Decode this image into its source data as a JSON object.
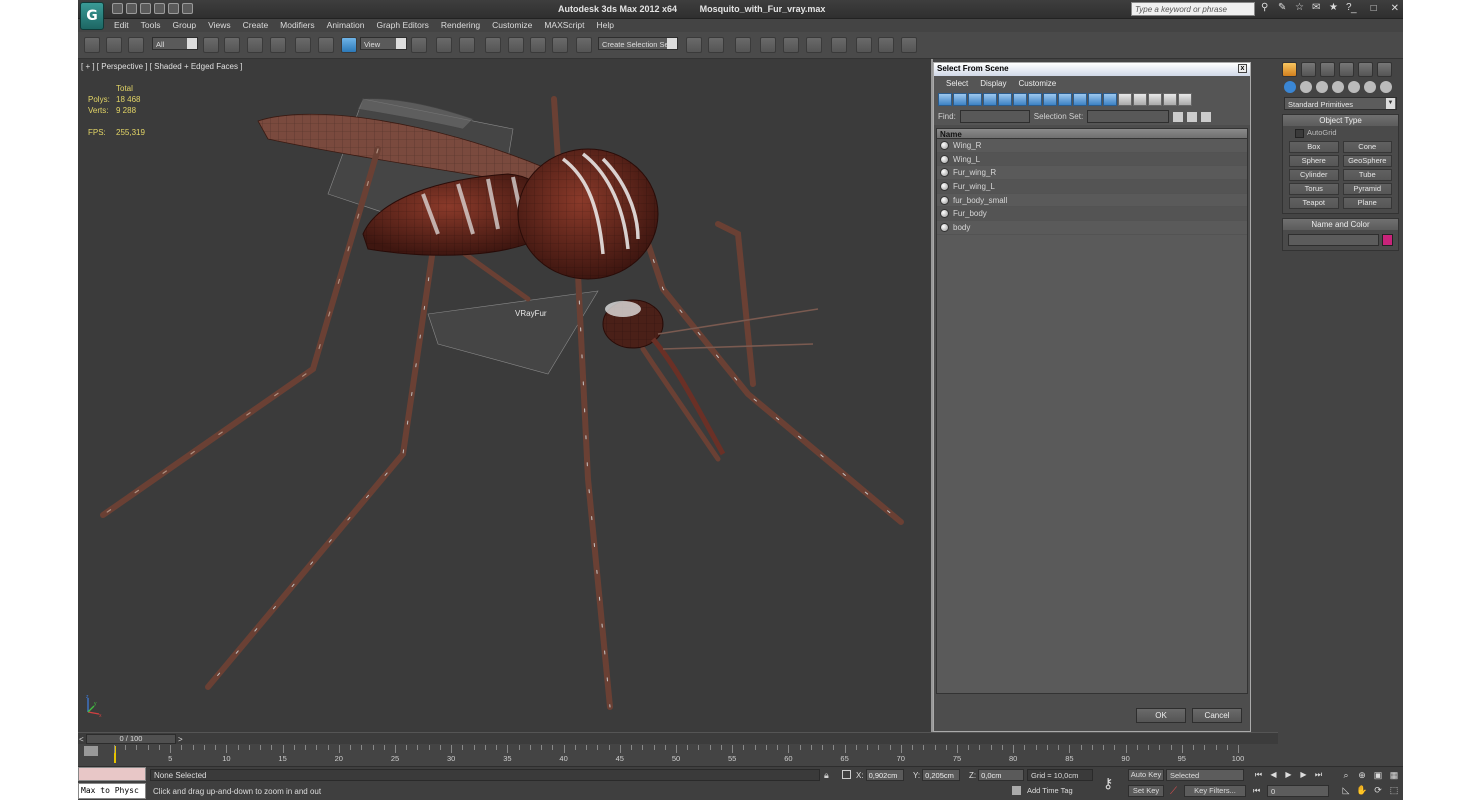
{
  "app": {
    "title": "Autodesk 3ds Max  2012 x64",
    "filename": "Mosquito_with_Fur_vray.max",
    "logo_letter": "G",
    "search_placeholder": "Type a keyword or phrase",
    "min": "_",
    "max": "□",
    "close": "✕"
  },
  "menu": [
    "Edit",
    "Tools",
    "Group",
    "Views",
    "Create",
    "Modifiers",
    "Animation",
    "Graph Editors",
    "Rendering",
    "Customize",
    "MAXScript",
    "Help"
  ],
  "toolbar": {
    "filter_value": "All",
    "ref_coord": "View",
    "selection_set_placeholder": "Create Selection Se"
  },
  "viewport": {
    "label": "[ + ] [ Perspective ] [ Shaded + Edged Faces ]",
    "stats_header": "Total",
    "polys_label": "Polys:",
    "polys_value": "18 468",
    "verts_label": "Verts:",
    "verts_value": "9 288",
    "fps_label": "FPS:",
    "fps_value": "255,319",
    "vrayfur_label": "VRayFur",
    "axis": {
      "x": "x",
      "y": "y",
      "z": "z"
    }
  },
  "dialog": {
    "title": "Select From Scene",
    "menu": [
      "Select",
      "Display",
      "Customize"
    ],
    "find_label": "Find:",
    "selection_set_label": "Selection Set:",
    "column_name": "Name",
    "objects": [
      "Wing_R",
      "Wing_L",
      "Fur_wing_R",
      "Fur_wing_L",
      "fur_body_small",
      "Fur_body",
      "body"
    ],
    "ok": "OK",
    "cancel": "Cancel"
  },
  "command_panel": {
    "dropdown": "Standard Primitives",
    "object_type_title": "Object Type",
    "autogrid": "AutoGrid",
    "buttons": [
      "Box",
      "Cone",
      "Sphere",
      "GeoSphere",
      "Cylinder",
      "Tube",
      "Torus",
      "Pyramid",
      "Teapot",
      "Plane"
    ],
    "name_color_title": "Name and Color",
    "object_color": "#c8237a"
  },
  "timeline": {
    "frame_display": "0 / 100",
    "prev": "<",
    "next": ">",
    "ticks": [
      "5",
      "10",
      "15",
      "20",
      "25",
      "30",
      "35",
      "40",
      "45",
      "50",
      "55",
      "60",
      "65",
      "70",
      "75",
      "80",
      "85",
      "90",
      "95",
      "100"
    ]
  },
  "status": {
    "maxscript": "Max to Physc",
    "selection": "None Selected",
    "prompt": "Click and drag up-and-down to zoom in and out",
    "x_label": "X:",
    "x_value": "0,902cm",
    "y_label": "Y:",
    "y_value": "0,205cm",
    "z_label": "Z:",
    "z_value": "0,0cm",
    "grid": "Grid = 10,0cm",
    "add_time_tag": "Add Time Tag",
    "auto_key": "Auto Key",
    "set_key": "Set Key",
    "selected_dropdown": "Selected",
    "key_filters": "Key Filters...",
    "current_frame": "0"
  }
}
